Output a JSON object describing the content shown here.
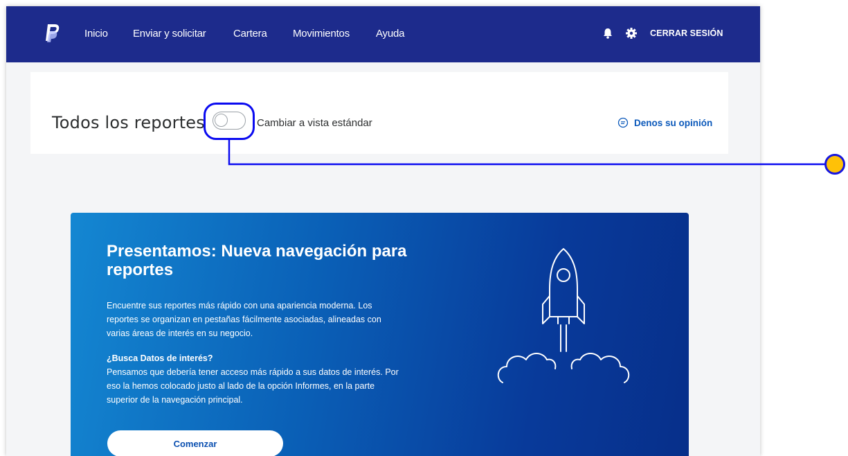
{
  "nav": {
    "links": [
      "Inicio",
      "Enviar y solicitar",
      "Cartera",
      "Movimientos",
      "Ayuda"
    ],
    "icons": [
      "bell-icon",
      "gear-icon"
    ],
    "logout": "CERRAR SESIÓN",
    "bg_color": "#1d2b8c"
  },
  "header": {
    "title": "Todos los reportes",
    "toggle_label": "Cambiar a vista estándar",
    "toggle_on": false,
    "feedback_label": "Denos su opinión"
  },
  "banner": {
    "title": "Presentamos: Nueva navegación para reportes",
    "paragraph1": "Encuentre sus reportes más rápido con una apariencia moderna. Los reportes se organizan en pestañas fácilmente asociadas, alineadas con varias áreas de interés en su negocio.",
    "subheading": "¿Busca Datos de interés?",
    "paragraph2": "Pensamos que debería tener acceso más rápido a sus datos de interés. Por eso la hemos colocado justo al lado de la opción Informes, en la parte superior de la navegación principal.",
    "button_label": "Comenzar",
    "illustration": "rocket-icon"
  },
  "annotation": {
    "highlight_color": "#0a0af0",
    "dot_color": "#ffc107"
  }
}
